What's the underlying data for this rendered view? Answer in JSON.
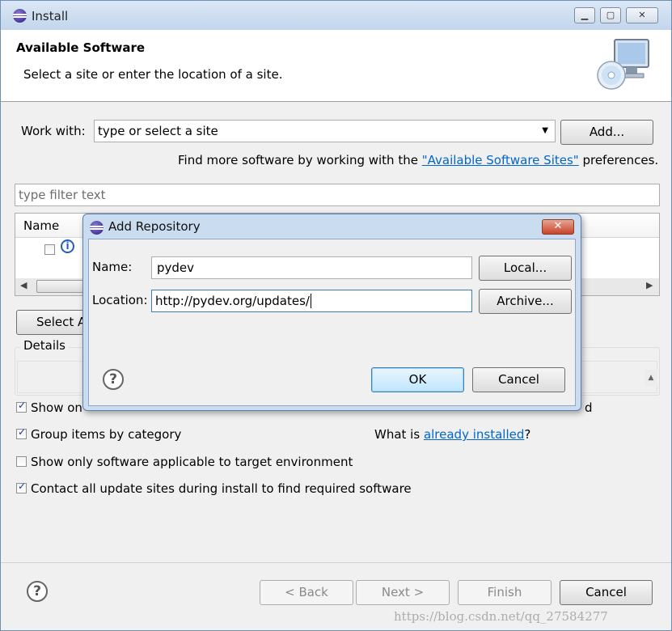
{
  "window": {
    "title": "Install"
  },
  "banner": {
    "heading": "Available Software",
    "subtitle": "Select a site or enter the location of a site."
  },
  "work_with": {
    "label": "Work with:",
    "value": "type or select a site",
    "add_label": "Add...",
    "hint_prefix": "Find more software by working with the ",
    "hint_link": "\"Available Software Sites\"",
    "hint_suffix": " preferences."
  },
  "filter": {
    "placeholder": "type filter text"
  },
  "table": {
    "column_name": "Name",
    "info_glyph": "i"
  },
  "select_all_label": "Select A",
  "details_label": "Details",
  "options": {
    "show_only": {
      "label": "Show on",
      "checked": true
    },
    "group_by_category": {
      "label": "Group items by category",
      "checked": true
    },
    "applicable_only": {
      "label": "Show only software applicable to target environment",
      "checked": false
    },
    "contact_all": {
      "label": "Contact all update sites during install to find required software",
      "checked": true
    },
    "right_partial": "d",
    "what_is_prefix": "What is ",
    "what_is_link": "already installed",
    "what_is_suffix": "?"
  },
  "footer": {
    "back": "< Back",
    "next": "Next >",
    "finish": "Finish",
    "cancel": "Cancel"
  },
  "dialog": {
    "title": "Add Repository",
    "name_label": "Name:",
    "name_value": "pydev",
    "location_label": "Location:",
    "location_value": "http://pydev.org/updates/",
    "local_button": "Local...",
    "archive_button": "Archive...",
    "ok_button": "OK",
    "cancel_button": "Cancel",
    "close_glyph": "✕"
  },
  "watermark": "https://blog.csdn.net/qq_27584277",
  "colors": {
    "title_bar": "#c3d6ec",
    "link": "#0066cc",
    "dialog_frame": "#c9dcf0",
    "close_button": "#c7432a"
  }
}
